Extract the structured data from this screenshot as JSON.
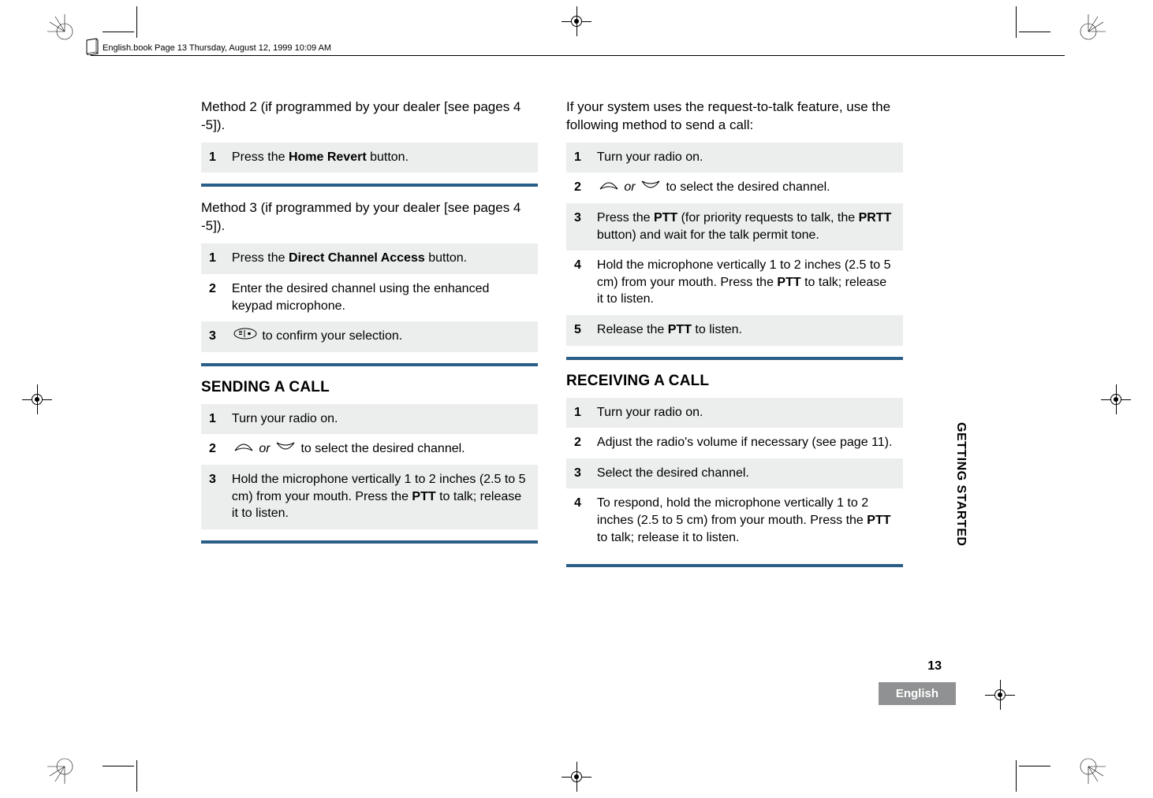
{
  "header": {
    "text": "English.book  Page 13  Thursday, August 12, 1999  10:09 AM"
  },
  "left": {
    "method2_intro": "Method 2 (if programmed by your dealer [see pages 4 -5]).",
    "m2_step1_pre": "Press the ",
    "m2_step1_bold": "Home Revert",
    "m2_step1_post": " button.",
    "method3_intro": "Method 3 (if programmed by your dealer [see pages 4 -5]).",
    "m3_step1_pre": "Press the ",
    "m3_step1_bold": "Direct Channel Access",
    "m3_step1_post": " button.",
    "m3_step2": "Enter the desired channel using the enhanced keypad microphone.",
    "m3_step3_post": " to confirm your selection.",
    "sending_h": "SENDING A CALL",
    "send_step1": "Turn your radio on.",
    "send_step2_mid": " or ",
    "send_step2_post": " to select the desired channel.",
    "send_step3_pre": "Hold the microphone vertically 1 to 2 inches (2.5 to 5 cm) from your mouth. Press the ",
    "send_step3_bold": "PTT",
    "send_step3_post": " to talk; release it to listen."
  },
  "right": {
    "rtt_intro": "If your system uses the request-to-talk feature, use the following method to send a call:",
    "rtt_step1": "Turn your radio on.",
    "rtt_step2_mid": " or ",
    "rtt_step2_post": " to select the desired channel.",
    "rtt_step3_pre": "Press the ",
    "rtt_step3_b1": "PTT",
    "rtt_step3_mid": " (for priority requests to talk, the ",
    "rtt_step3_b2": "PRTT",
    "rtt_step3_post": " button) and wait for the talk permit tone.",
    "rtt_step4_pre": "Hold the microphone vertically 1 to 2 inches (2.5 to 5 cm) from your mouth. Press the ",
    "rtt_step4_b": "PTT",
    "rtt_step4_post": " to talk; release it to listen.",
    "rtt_step5_pre": "Release the ",
    "rtt_step5_b": "PTT",
    "rtt_step5_post": " to listen.",
    "recv_h": "RECEIVING A CALL",
    "recv_step1": "Turn your radio on.",
    "recv_step2": "Adjust the radio's volume if necessary (see page 11).",
    "recv_step3": "Select the desired channel.",
    "recv_step4_pre": "To respond, hold the microphone vertically 1 to 2 inches (2.5 to 5 cm) from your mouth. Press the ",
    "recv_step4_b": "PTT",
    "recv_step4_post": " to talk; release it to listen."
  },
  "nums": {
    "n1": "1",
    "n2": "2",
    "n3": "3",
    "n4": "4",
    "n5": "5"
  },
  "sidebar": "GETTING STARTED",
  "page_num": "13",
  "footer_lang": "English"
}
